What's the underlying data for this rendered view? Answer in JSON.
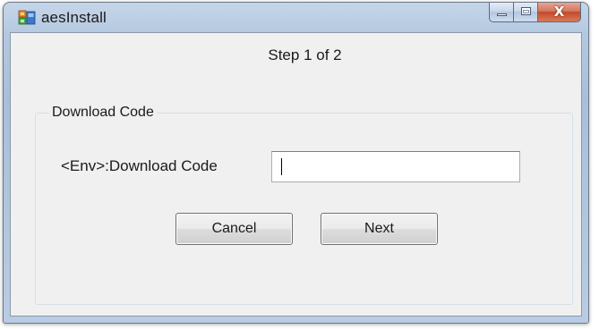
{
  "window": {
    "title": "aesInstall",
    "icon": "installer-app-icon",
    "controls": {
      "minimize": "minimize-icon",
      "maximize": "maximize-icon",
      "close": "close-icon",
      "close_glyph": "X"
    }
  },
  "form": {
    "step_label": "Step 1 of 2",
    "group_title": "Download Code",
    "field_label": "<Env>:Download Code",
    "field_value": "",
    "cancel_label": "Cancel",
    "next_label": "Next"
  },
  "colors": {
    "client_background": "#f0f0f0",
    "close_button": "#c14a2c",
    "title_bar": "#b4c8e0"
  }
}
